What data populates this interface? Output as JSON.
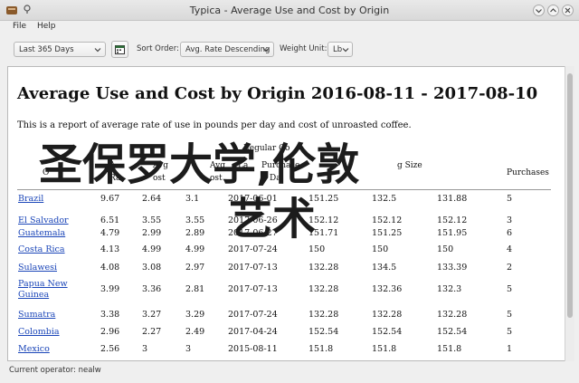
{
  "window": {
    "title": "Typica - Average Use and Cost by Origin"
  },
  "menu": [
    "File",
    "Help"
  ],
  "toolbar": {
    "date_range": "Last 365 Days",
    "sort_order_label": "Sort Order:",
    "sort_order_value": "Avg. Rate Descending",
    "weight_unit_label": "Weight Unit:",
    "weight_unit_value": "Lb"
  },
  "report": {
    "title": "Average Use and Cost by Origin 2016-08-11 - 2017-08-10",
    "description": "This is a report of average rate of use in pounds per day and cost of unroasted coffee.",
    "group_header": "Regular Co",
    "columns": [
      "O",
      "A",
      "Avg",
      "Avg",
      "La",
      "Purchase",
      "Da",
      "g Size",
      "Purchases"
    ],
    "column_fragments": [
      "Ra",
      "ost",
      "Avg",
      "ost",
      "Purchases"
    ],
    "rows": [
      {
        "origin": "Brazil",
        "rate": "9.67",
        "c1": "2.64",
        "c2": "3.1",
        "date": "2017-06-01",
        "s1": "151.25",
        "s2": "132.5",
        "s3": "131.88",
        "n": "5"
      },
      {
        "origin": "El Salvador",
        "rate": "6.51",
        "c1": "3.55",
        "c2": "3.55",
        "date": "2017-06-26",
        "s1": "152.12",
        "s2": "152.12",
        "s3": "152.12",
        "n": "3"
      },
      {
        "origin": "Guatemala",
        "rate": "4.79",
        "c1": "2.99",
        "c2": "2.89",
        "date": "2017-06-27",
        "s1": "151.71",
        "s2": "151.25",
        "s3": "151.95",
        "n": "6"
      },
      {
        "origin": "Costa Rica",
        "rate": "4.13",
        "c1": "4.99",
        "c2": "4.99",
        "date": "2017-07-24",
        "s1": "150",
        "s2": "150",
        "s3": "150",
        "n": "4"
      },
      {
        "origin": "Sulawesi",
        "rate": "4.08",
        "c1": "3.08",
        "c2": "2.97",
        "date": "2017-07-13",
        "s1": "132.28",
        "s2": "134.5",
        "s3": "133.39",
        "n": "2"
      },
      {
        "origin": "Papua New Guinea",
        "origin_line1": "Papua New",
        "origin_line2": "Guinea",
        "rate": "3.99",
        "c1": "3.36",
        "c2": "2.81",
        "date": "2017-07-13",
        "s1": "132.28",
        "s2": "132.36",
        "s3": "132.3",
        "n": "5"
      },
      {
        "origin": "Sumatra",
        "rate": "3.38",
        "c1": "3.27",
        "c2": "3.29",
        "date": "2017-07-24",
        "s1": "132.28",
        "s2": "132.28",
        "s3": "132.28",
        "n": "5"
      },
      {
        "origin": "Colombia",
        "rate": "2.96",
        "c1": "2.27",
        "c2": "2.49",
        "date": "2017-04-24",
        "s1": "152.54",
        "s2": "152.54",
        "s3": "152.54",
        "n": "5"
      },
      {
        "origin": "Mexico",
        "rate": "2.56",
        "c1": "3",
        "c2": "3",
        "date": "2015-08-11",
        "s1": "151.8",
        "s2": "151.8",
        "s3": "151.8",
        "n": "1"
      }
    ]
  },
  "watermark": {
    "line1": "圣保罗大学,伦敦",
    "line2": "艺术"
  },
  "status": "Current operator: nealw"
}
